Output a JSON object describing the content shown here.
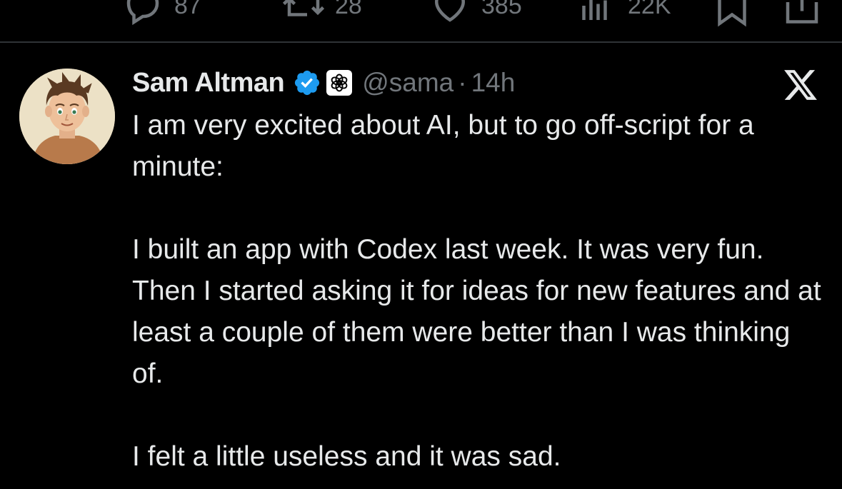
{
  "previous_tweet": {
    "actions": [
      {
        "name": "reply",
        "icon": "reply-icon",
        "count": "87"
      },
      {
        "name": "retweet",
        "icon": "retweet-icon",
        "count": "28"
      },
      {
        "name": "like",
        "icon": "heart-icon",
        "count": "385"
      },
      {
        "name": "views",
        "icon": "views-icon",
        "count": "22K"
      },
      {
        "name": "bookmark",
        "icon": "bookmark-icon"
      },
      {
        "name": "share",
        "icon": "share-icon"
      }
    ]
  },
  "tweet": {
    "author": {
      "display_name": "Sam Altman",
      "handle": "@sama",
      "verified": true,
      "verified_icon": "verified-badge-icon",
      "affiliate_icon": "openai-logo-icon",
      "avatar_icon": "avatar-illustration"
    },
    "separator": "·",
    "time": "14h",
    "platform_icon": "x-logo-icon",
    "paragraphs": [
      "I am very excited about AI, but to go off-script for a minute:",
      "I built an app with Codex last week. It was very fun. Then I started asking it for ideas for new features and at least a couple of them were better than I was thinking of.",
      "I felt a little useless and it was sad."
    ]
  },
  "colors": {
    "background": "#000000",
    "text_primary": "#e7e9ea",
    "text_secondary": "#71767b",
    "divider": "#2f3336",
    "verified_blue": "#1d9bf0"
  }
}
